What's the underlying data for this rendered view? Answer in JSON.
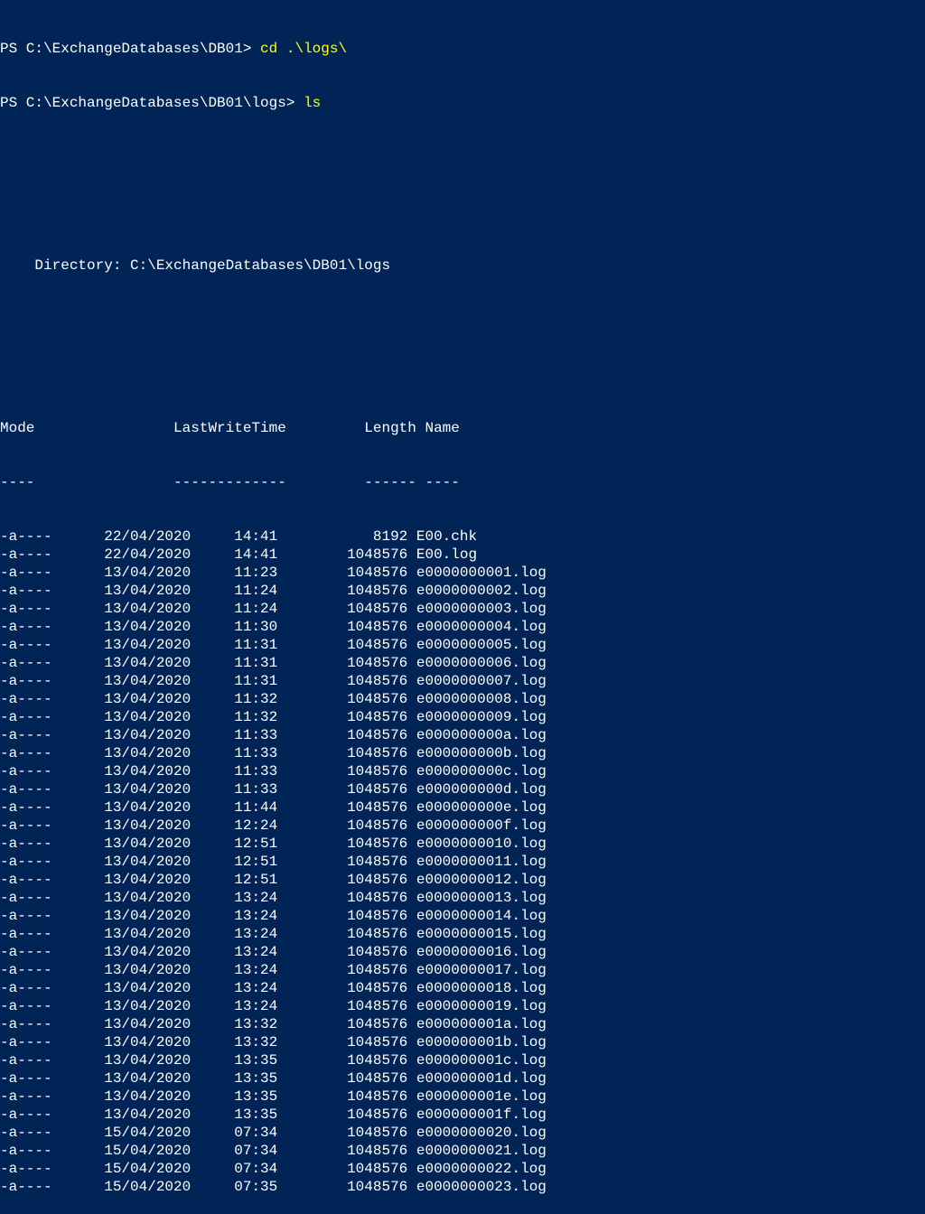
{
  "prompts": [
    {
      "prefix": "PS C:\\ExchangeDatabases\\DB01> ",
      "command": "cd .\\logs\\"
    },
    {
      "prefix": "PS C:\\ExchangeDatabases\\DB01\\logs> ",
      "command": "ls"
    }
  ],
  "directory_label": "    Directory: C:\\ExchangeDatabases\\DB01\\logs",
  "headers": {
    "mode": "Mode",
    "lastwrite": "LastWriteTime",
    "length": "Length",
    "name": "Name"
  },
  "header_line": "Mode                LastWriteTime         Length Name",
  "separator_line": "----                -------------         ------ ----",
  "files": [
    {
      "mode": "-a----",
      "date": "22/04/2020",
      "time": "14:41",
      "length": "8192",
      "name": "E00.chk"
    },
    {
      "mode": "-a----",
      "date": "22/04/2020",
      "time": "14:41",
      "length": "1048576",
      "name": "E00.log"
    },
    {
      "mode": "-a----",
      "date": "13/04/2020",
      "time": "11:23",
      "length": "1048576",
      "name": "e0000000001.log"
    },
    {
      "mode": "-a----",
      "date": "13/04/2020",
      "time": "11:24",
      "length": "1048576",
      "name": "e0000000002.log"
    },
    {
      "mode": "-a----",
      "date": "13/04/2020",
      "time": "11:24",
      "length": "1048576",
      "name": "e0000000003.log"
    },
    {
      "mode": "-a----",
      "date": "13/04/2020",
      "time": "11:30",
      "length": "1048576",
      "name": "e0000000004.log"
    },
    {
      "mode": "-a----",
      "date": "13/04/2020",
      "time": "11:31",
      "length": "1048576",
      "name": "e0000000005.log"
    },
    {
      "mode": "-a----",
      "date": "13/04/2020",
      "time": "11:31",
      "length": "1048576",
      "name": "e0000000006.log"
    },
    {
      "mode": "-a----",
      "date": "13/04/2020",
      "time": "11:31",
      "length": "1048576",
      "name": "e0000000007.log"
    },
    {
      "mode": "-a----",
      "date": "13/04/2020",
      "time": "11:32",
      "length": "1048576",
      "name": "e0000000008.log"
    },
    {
      "mode": "-a----",
      "date": "13/04/2020",
      "time": "11:32",
      "length": "1048576",
      "name": "e0000000009.log"
    },
    {
      "mode": "-a----",
      "date": "13/04/2020",
      "time": "11:33",
      "length": "1048576",
      "name": "e000000000a.log"
    },
    {
      "mode": "-a----",
      "date": "13/04/2020",
      "time": "11:33",
      "length": "1048576",
      "name": "e000000000b.log"
    },
    {
      "mode": "-a----",
      "date": "13/04/2020",
      "time": "11:33",
      "length": "1048576",
      "name": "e000000000c.log"
    },
    {
      "mode": "-a----",
      "date": "13/04/2020",
      "time": "11:33",
      "length": "1048576",
      "name": "e000000000d.log"
    },
    {
      "mode": "-a----",
      "date": "13/04/2020",
      "time": "11:44",
      "length": "1048576",
      "name": "e000000000e.log"
    },
    {
      "mode": "-a----",
      "date": "13/04/2020",
      "time": "12:24",
      "length": "1048576",
      "name": "e000000000f.log"
    },
    {
      "mode": "-a----",
      "date": "13/04/2020",
      "time": "12:51",
      "length": "1048576",
      "name": "e0000000010.log"
    },
    {
      "mode": "-a----",
      "date": "13/04/2020",
      "time": "12:51",
      "length": "1048576",
      "name": "e0000000011.log"
    },
    {
      "mode": "-a----",
      "date": "13/04/2020",
      "time": "12:51",
      "length": "1048576",
      "name": "e0000000012.log"
    },
    {
      "mode": "-a----",
      "date": "13/04/2020",
      "time": "13:24",
      "length": "1048576",
      "name": "e0000000013.log"
    },
    {
      "mode": "-a----",
      "date": "13/04/2020",
      "time": "13:24",
      "length": "1048576",
      "name": "e0000000014.log"
    },
    {
      "mode": "-a----",
      "date": "13/04/2020",
      "time": "13:24",
      "length": "1048576",
      "name": "e0000000015.log"
    },
    {
      "mode": "-a----",
      "date": "13/04/2020",
      "time": "13:24",
      "length": "1048576",
      "name": "e0000000016.log"
    },
    {
      "mode": "-a----",
      "date": "13/04/2020",
      "time": "13:24",
      "length": "1048576",
      "name": "e0000000017.log"
    },
    {
      "mode": "-a----",
      "date": "13/04/2020",
      "time": "13:24",
      "length": "1048576",
      "name": "e0000000018.log"
    },
    {
      "mode": "-a----",
      "date": "13/04/2020",
      "time": "13:24",
      "length": "1048576",
      "name": "e0000000019.log"
    },
    {
      "mode": "-a----",
      "date": "13/04/2020",
      "time": "13:32",
      "length": "1048576",
      "name": "e000000001a.log"
    },
    {
      "mode": "-a----",
      "date": "13/04/2020",
      "time": "13:32",
      "length": "1048576",
      "name": "e000000001b.log"
    },
    {
      "mode": "-a----",
      "date": "13/04/2020",
      "time": "13:35",
      "length": "1048576",
      "name": "e000000001c.log"
    },
    {
      "mode": "-a----",
      "date": "13/04/2020",
      "time": "13:35",
      "length": "1048576",
      "name": "e000000001d.log"
    },
    {
      "mode": "-a----",
      "date": "13/04/2020",
      "time": "13:35",
      "length": "1048576",
      "name": "e000000001e.log"
    },
    {
      "mode": "-a----",
      "date": "13/04/2020",
      "time": "13:35",
      "length": "1048576",
      "name": "e000000001f.log"
    },
    {
      "mode": "-a----",
      "date": "15/04/2020",
      "time": "07:34",
      "length": "1048576",
      "name": "e0000000020.log"
    },
    {
      "mode": "-a----",
      "date": "15/04/2020",
      "time": "07:34",
      "length": "1048576",
      "name": "e0000000021.log"
    },
    {
      "mode": "-a----",
      "date": "15/04/2020",
      "time": "07:34",
      "length": "1048576",
      "name": "e0000000022.log"
    },
    {
      "mode": "-a----",
      "date": "15/04/2020",
      "time": "07:35",
      "length": "1048576",
      "name": "e0000000023.log"
    }
  ]
}
